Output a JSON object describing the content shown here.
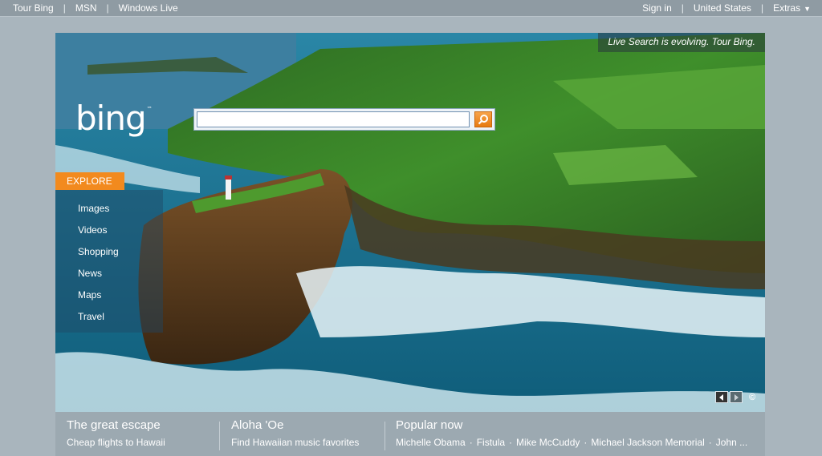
{
  "topbar": {
    "left_links": [
      "Tour Bing",
      "MSN",
      "Windows Live"
    ],
    "right_links": [
      "Sign in",
      "United States"
    ],
    "extras_label": "Extras",
    "extras_icon": "caret-down-icon"
  },
  "hero": {
    "tagline": "Live Search is evolving. Tour Bing.",
    "logo": "bing",
    "logo_mark": "™",
    "search": {
      "value": "",
      "placeholder": "",
      "button_icon": "search-icon"
    },
    "explore_label": "EXPLORE",
    "nav_items": [
      "Images",
      "Videos",
      "Shopping",
      "News",
      "Maps",
      "Travel"
    ],
    "copyright": "©"
  },
  "bottom": {
    "col1": {
      "title": "The great escape",
      "text": "Cheap flights to Hawaii"
    },
    "col2": {
      "title": "Aloha 'Oe",
      "text": "Find Hawaiian music favorites"
    },
    "col3": {
      "title": "Popular now",
      "links": [
        "Michelle Obama",
        "Fistula",
        "Mike McCuddy",
        "Michael Jackson Memorial",
        "John ..."
      ]
    }
  },
  "colors": {
    "accent": "#f28a1e",
    "page_bg": "#a9b5bd",
    "topbar_bg": "#8f9ba3"
  }
}
